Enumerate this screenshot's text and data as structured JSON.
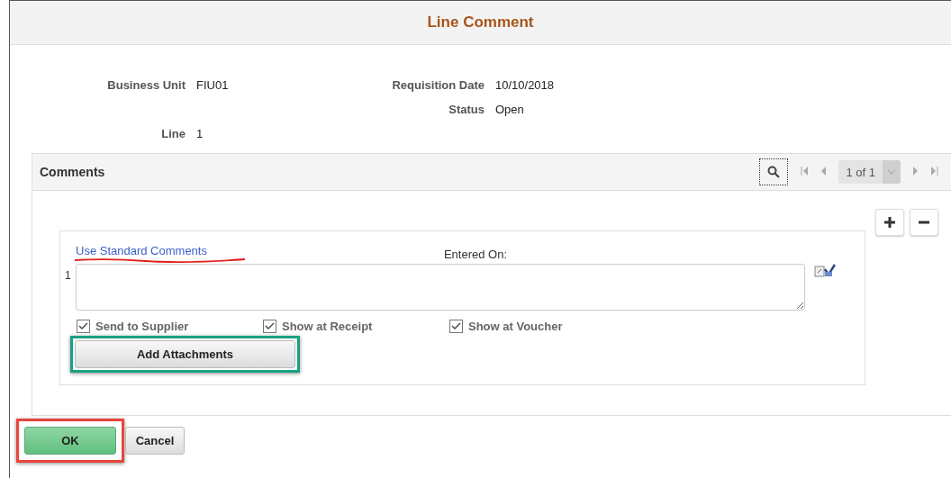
{
  "window": {
    "title": "Line Comment"
  },
  "fields": [
    {
      "label": "Business Unit",
      "value": "FIU01"
    },
    {
      "label": "Requisition Date",
      "value": "10/10/2018"
    },
    {
      "label": "Status",
      "value": "Open"
    },
    {
      "label": "Line",
      "value": "1"
    }
  ],
  "comments": {
    "title": "Comments",
    "pager": "1 of 1",
    "row_number": "1",
    "standard_link": {
      "label": "Use Standard Comments",
      "annotated": true
    },
    "entered_on_label": "Entered On:",
    "checkboxes": [
      {
        "label": "Send to Supplier",
        "checked": true
      },
      {
        "label": "Show at Receipt",
        "checked": true
      },
      {
        "label": "Show at Voucher",
        "checked": true
      }
    ],
    "attachments_button": {
      "label": "Add Attachments",
      "annotated": true
    }
  },
  "buttons": [
    {
      "label": "OK",
      "kind": "primary",
      "annotated": true
    },
    {
      "label": "Cancel",
      "kind": "secondary",
      "annotated": false
    }
  ]
}
